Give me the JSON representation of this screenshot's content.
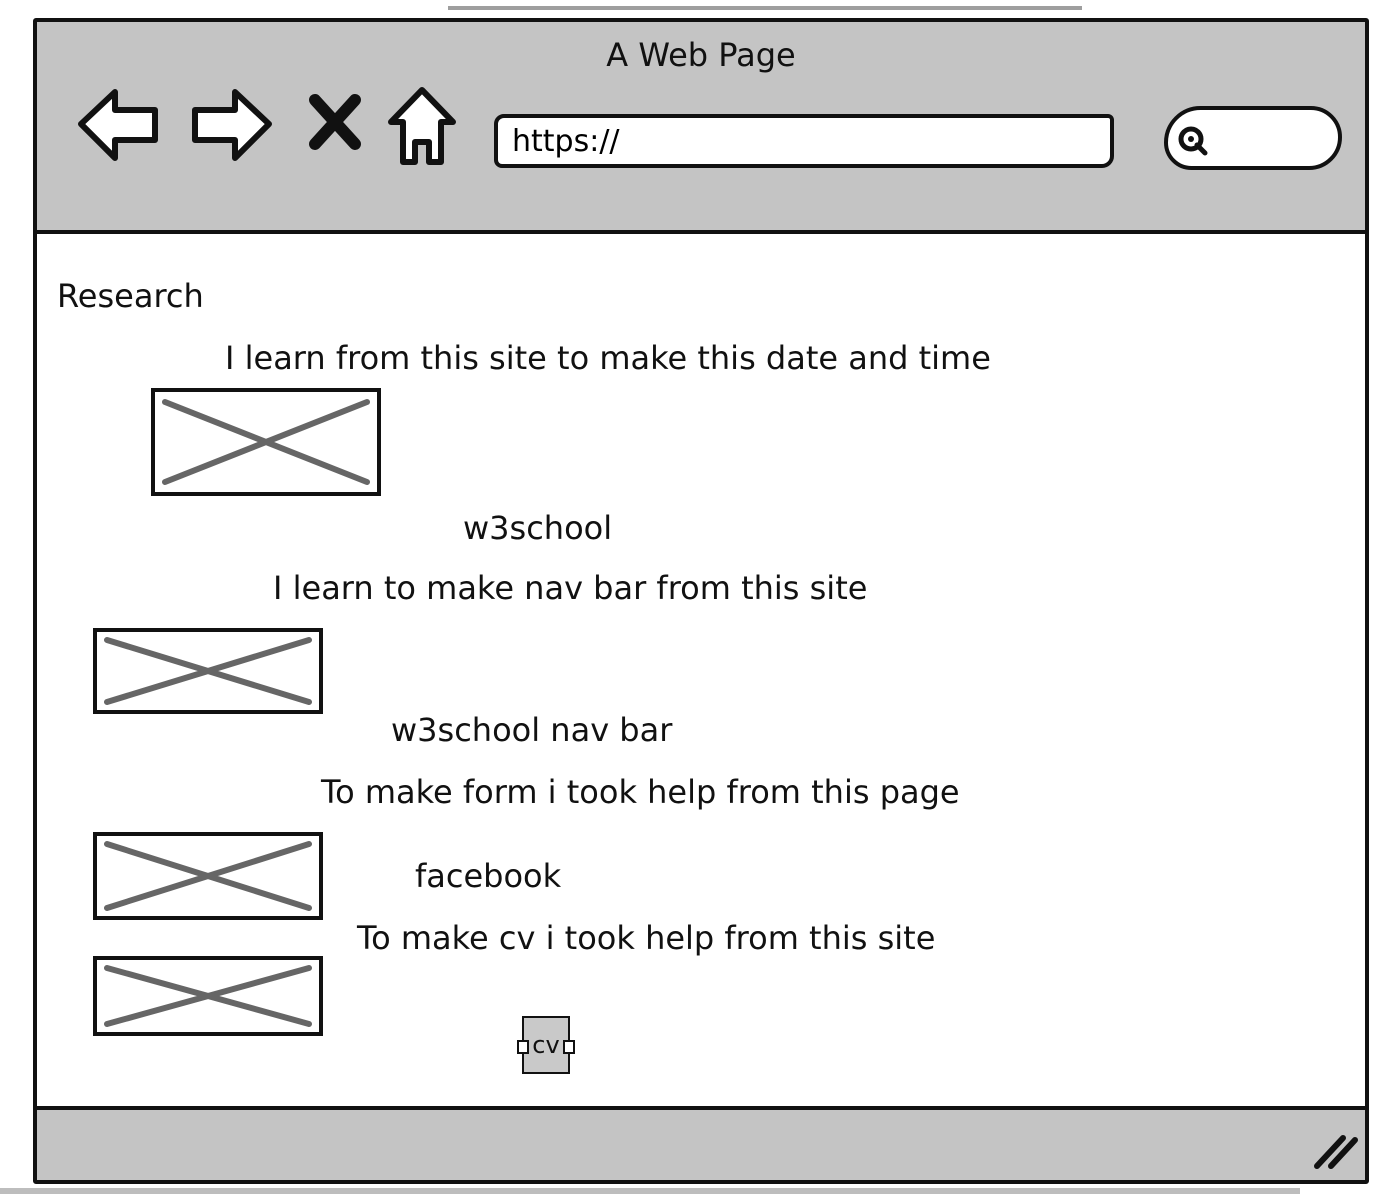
{
  "window": {
    "title": "A Web Page",
    "url_value": "https://",
    "search_placeholder": ""
  },
  "content": {
    "heading": "Research",
    "items": [
      {
        "description": "I learn from this site to make this date and time",
        "link_label": "w3school"
      },
      {
        "description": "I learn to make nav bar from this site",
        "link_label": "w3school nav bar"
      },
      {
        "description": "To make form i took help from this page",
        "link_label": "facebook"
      },
      {
        "description": "To make cv i took help from this site",
        "link_label": "cv"
      }
    ]
  }
}
